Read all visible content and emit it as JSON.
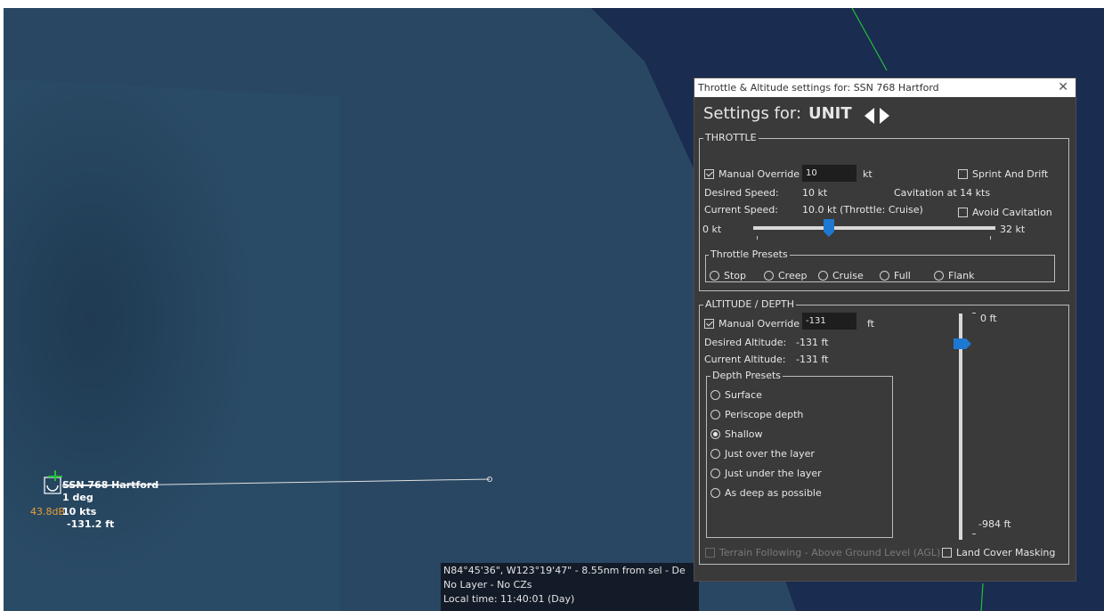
{
  "map": {
    "unit": {
      "name": "SSN 768 Hartford",
      "course": "1 deg",
      "speed": "10 kts",
      "depth": "-131.2 ft",
      "noise": "43.8dB"
    },
    "status": {
      "coords": "N84°45'36\", W123°19'47\" - 8.55nm from sel - De",
      "layer": "No Layer - No CZs",
      "time": "Local time: 11:40:01 (Day)"
    }
  },
  "dialog": {
    "title": "Throttle & Altitude settings for: SSN 768 Hartford",
    "close_icon": "close-icon",
    "settings_for_label": "Settings for:",
    "settings_for_value": "UNIT",
    "throttle": {
      "group_label": "THROTTLE",
      "manual_override_label": "Manual Override",
      "manual_override_value": "10",
      "unit_label": "kt",
      "sprint_drift_label": "Sprint And Drift",
      "desired_speed_label": "Desired Speed:",
      "desired_speed_value": "10 kt",
      "cavitation_text": "Cavitation at 14 kts",
      "current_speed_label": "Current Speed:",
      "current_speed_value": "10.0 kt (Throttle: Cruise)",
      "avoid_cavitation_label": "Avoid Cavitation",
      "min_label": "0 kt",
      "max_label": "32 kt",
      "slider_fraction": 0.3125,
      "presets_label": "Throttle Presets",
      "presets": [
        "Stop",
        "Creep",
        "Cruise",
        "Full",
        "Flank"
      ]
    },
    "altitude": {
      "group_label": "ALTITUDE / DEPTH",
      "manual_override_label": "Manual Override",
      "manual_override_value": "-131",
      "unit_label": "ft",
      "desired_label": "Desired Altitude:",
      "desired_value": "-131 ft",
      "current_label": "Current Altitude:",
      "current_value": "-131 ft",
      "top_label": "0 ft",
      "bottom_label": "-984 ft",
      "slider_fraction": 0.133,
      "presets_label": "Depth Presets",
      "presets": [
        "Surface",
        "Periscope depth",
        "Shallow",
        "Just over the layer",
        "Just under the layer",
        "As deep as possible"
      ],
      "selected_preset": "Shallow",
      "terrain_following_label": "Terrain Following - Above Ground Level (AGL)",
      "land_cover_label": "Land Cover Masking"
    },
    "colors": {
      "accent": "#1e78d2",
      "panel": "#3a3a3a"
    }
  }
}
